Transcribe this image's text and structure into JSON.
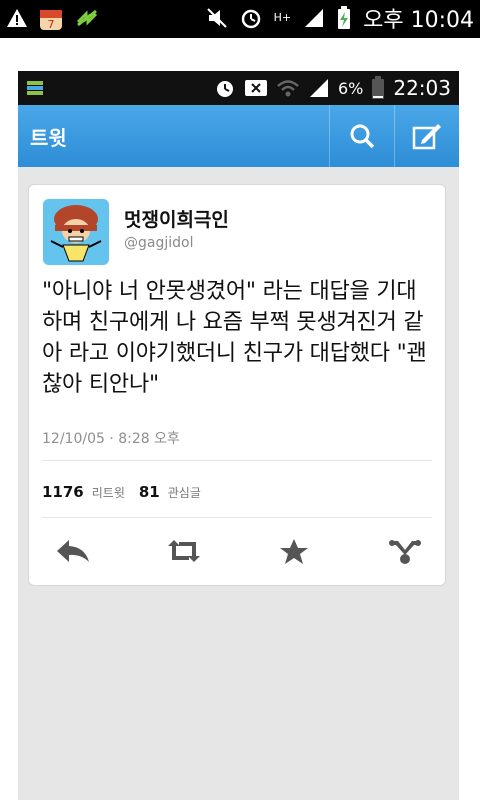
{
  "status_bar": {
    "time": "오후 10:04",
    "network_label": "H+"
  },
  "inner_status_bar": {
    "battery": "6%",
    "time": "22:03"
  },
  "app_bar": {
    "title": "트윗"
  },
  "tweet": {
    "display_name": "멋쟁이희극인",
    "handle": "@gagjidol",
    "text": "\"아니야 너 안못생겼어\" 라는 대답을 기대하며 친구에게 나 요즘 부쩍 못생겨진거 같아 라고 이야기했더니 친구가 대답했다 \"괜찮아 티안나\"",
    "timestamp": "12/10/05 · 8:28 오후",
    "retweet_count": "1176",
    "retweet_label": "리트윗",
    "favorite_count": "81",
    "favorite_label": "관심글"
  },
  "colors": {
    "app_bar": "#2d8dd6",
    "background": "#e6e6e6",
    "icon_gray": "#555555"
  }
}
